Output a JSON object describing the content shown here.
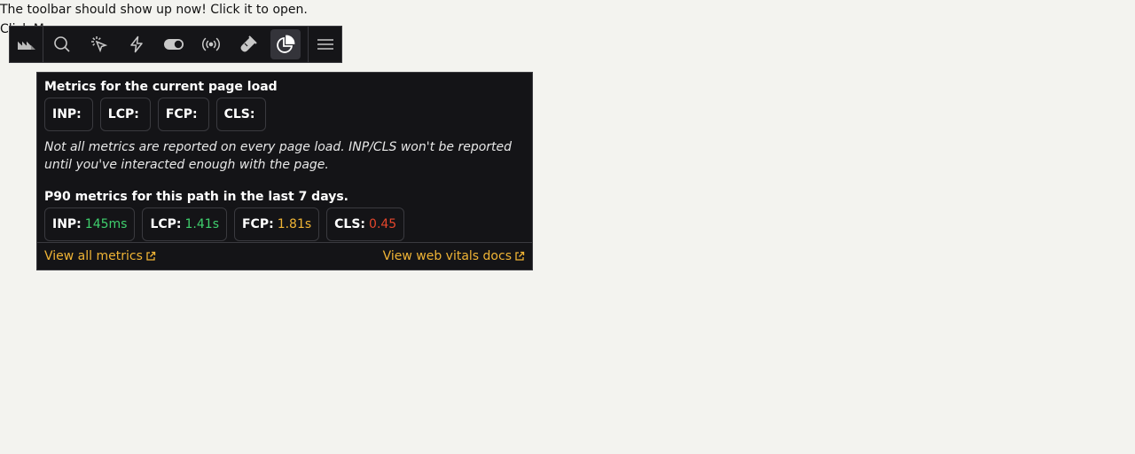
{
  "page": {
    "line1": "The toolbar should show up now! Click it to open.",
    "line2": "Click M"
  },
  "toolbar": {
    "logo_icon": "posthog-logo-icon",
    "buttons": [
      {
        "icon": "search-icon"
      },
      {
        "icon": "cursor-click-icon"
      },
      {
        "icon": "lightning-icon"
      },
      {
        "icon": "toggle-icon"
      },
      {
        "icon": "broadcast-icon"
      },
      {
        "icon": "flask-icon"
      },
      {
        "icon": "pie-chart-icon",
        "active": true
      }
    ],
    "menu_icon": "menu-icon"
  },
  "panel": {
    "current_title": "Metrics for the current page load",
    "current_metrics": [
      {
        "label": "INP:",
        "value": ""
      },
      {
        "label": "LCP:",
        "value": ""
      },
      {
        "label": "FCP:",
        "value": ""
      },
      {
        "label": "CLS:",
        "value": ""
      }
    ],
    "note": "Not all metrics are reported on every page load. INP/CLS won't be reported until you've interacted enough with the page.",
    "p90_title": "P90 metrics for this path in the last 7 days.",
    "p90_metrics": [
      {
        "label": "INP:",
        "value": "145ms",
        "status": "good"
      },
      {
        "label": "LCP:",
        "value": "1.41s",
        "status": "good"
      },
      {
        "label": "FCP:",
        "value": "1.81s",
        "status": "warn"
      },
      {
        "label": "CLS:",
        "value": "0.45",
        "status": "bad"
      }
    ],
    "footer_left": "View all metrics",
    "footer_right": "View web vitals docs"
  },
  "colors": {
    "good": "#3fcf6d",
    "warn": "#f0b435",
    "bad": "#e5462c",
    "panel_bg": "#141417",
    "page_bg": "#f3f3ef"
  }
}
